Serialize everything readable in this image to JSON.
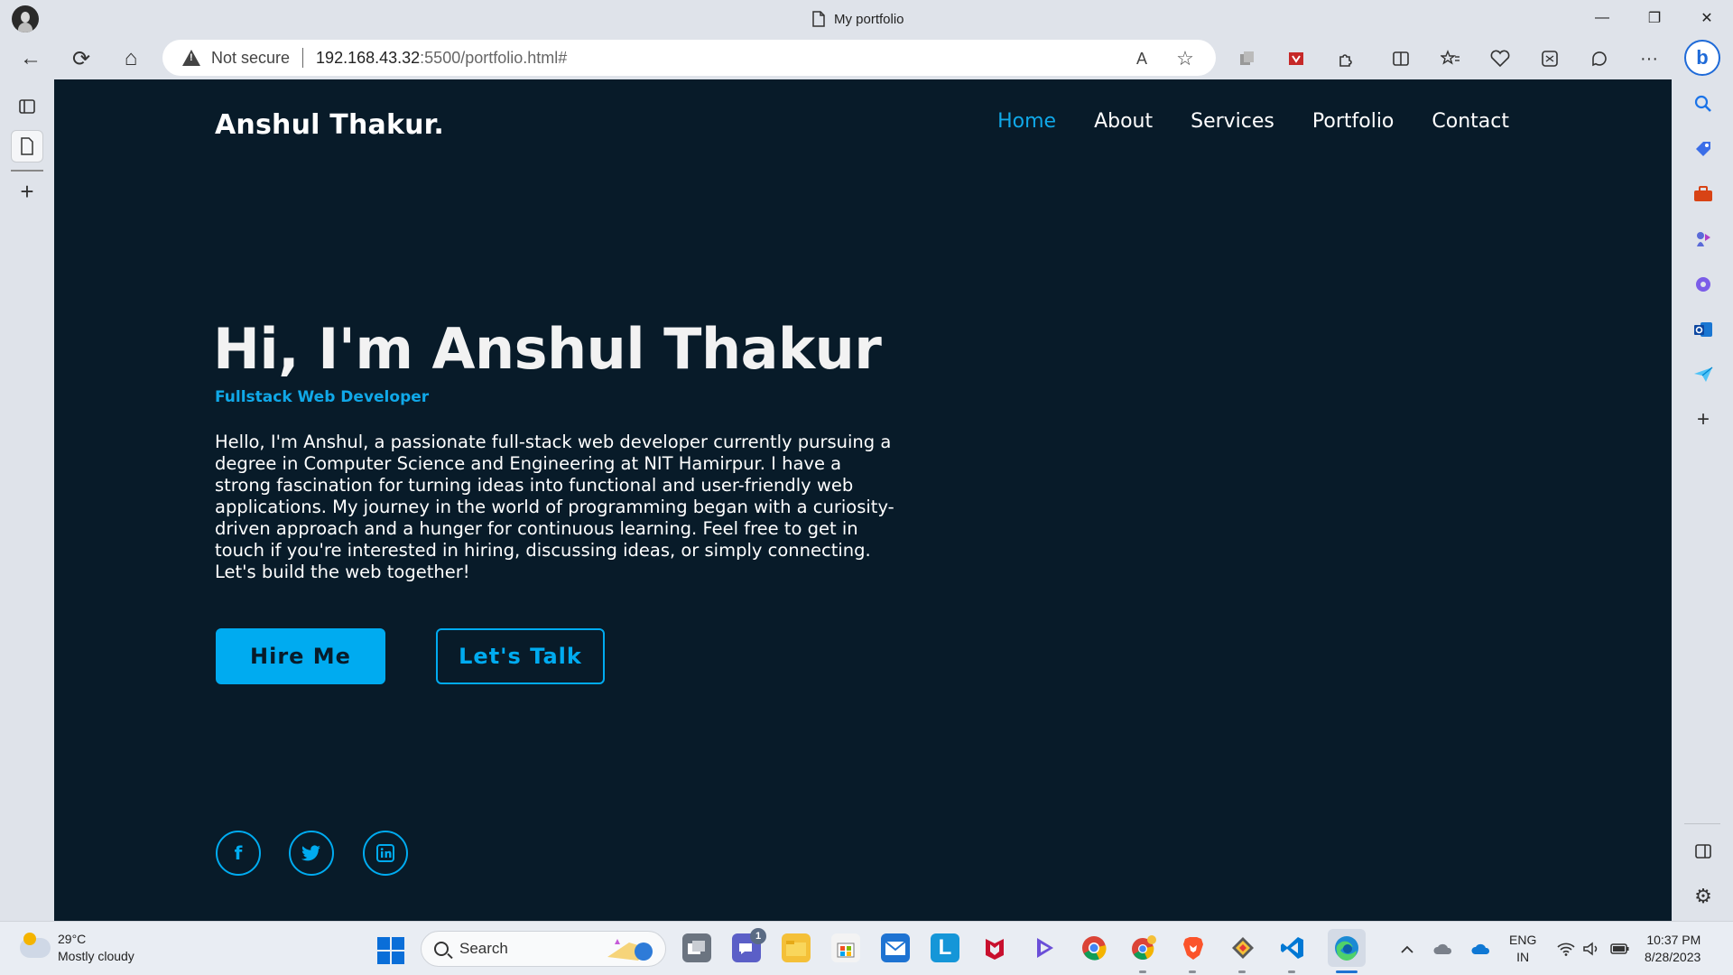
{
  "browser": {
    "tab_title": "My portfolio",
    "security_label": "Not secure",
    "url_host": "192.168.43.32",
    "url_rest": ":5500/portfolio.html#",
    "minimize_icon": "—",
    "maximize_icon": "❐",
    "close_icon": "✕",
    "back_icon": "←",
    "refresh_icon": "⟳",
    "home_icon": "⌂",
    "read_aloud_icon": "A",
    "favorite_icon": "☆",
    "more_icon": "···",
    "bing_icon": "b"
  },
  "site": {
    "logo": "Anshul Thakur.",
    "nav": [
      {
        "label": "Home",
        "active": true
      },
      {
        "label": "About",
        "active": false
      },
      {
        "label": "Services",
        "active": false
      },
      {
        "label": "Portfolio",
        "active": false
      },
      {
        "label": "Contact",
        "active": false
      }
    ],
    "hero": {
      "title": "Hi, I'm Anshul Thakur",
      "subtitle": "Fullstack Web Developer",
      "text": "Hello, I'm Anshul, a passionate full-stack web developer currently pursuing a degree in Computer Science and Engineering at NIT Hamirpur. I have a strong fascination for turning ideas into functional and user-friendly web applications. My journey in the world of programming began with a curiosity-driven approach and a hunger for continuous learning. Feel free to get in touch if you're interested in hiring, discussing ideas, or simply connecting. Let's build the web together!"
    },
    "buttons": {
      "hire": "Hire Me",
      "talk": "Let's Talk"
    },
    "social": [
      {
        "name": "facebook-icon",
        "glyph": "f"
      },
      {
        "name": "twitter-icon",
        "glyph": "t"
      },
      {
        "name": "linkedin-icon",
        "glyph": "in"
      }
    ],
    "colors": {
      "background": "#081b29",
      "accent": "#00abf0",
      "text": "#ededed"
    }
  },
  "taskbar": {
    "weather_temp": "29°C",
    "weather_desc": "Mostly cloudy",
    "search_label": "Search",
    "chat_badge": "1",
    "lang_line1": "ENG",
    "lang_line2": "IN",
    "time": "10:37 PM",
    "date": "8/28/2023"
  }
}
